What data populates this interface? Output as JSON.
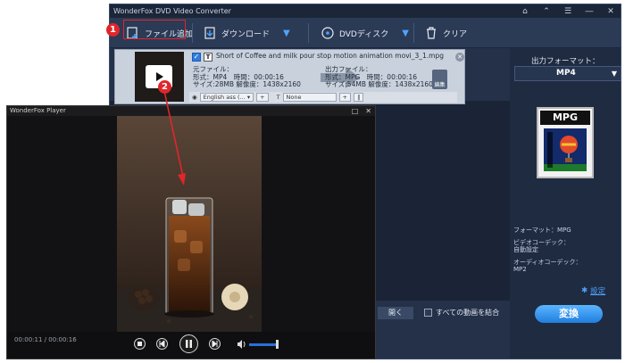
{
  "converter": {
    "title": "WonderFox DVD Video Converter",
    "window_controls": [
      "⌂",
      "⌃",
      "☰",
      "―",
      "✕"
    ],
    "toolbar": {
      "add_files_label": "ファイル追加",
      "download_label": "ダウンロード",
      "dvd_label": "DVDディスク",
      "clear_label": "クリア"
    },
    "file": {
      "name": "Short of Coffee and milk pour stop motion animation movi_3_1.mpg",
      "source_heading": "元ファイル：",
      "source_format": "形式：MP4　時間：00:00:16",
      "source_size": "サイズ:28MB 解像度：1438x2160",
      "output_heading": "出力ファイル：",
      "output_format": "形式：MPG　時間：00:00:16",
      "output_size": "サイズ:54MB 解像度：1438x2160",
      "edit_label": "編集",
      "subtitle_select": "English ass (... ▾",
      "audio_select": "None"
    },
    "right_panel": {
      "output_format_label": "出力フォーマット：",
      "selected_format": "MP4",
      "format_icon_text": "MPG",
      "format_line": "フォーマット：MPG",
      "video_codec_label": "ビデオコーデック：",
      "video_codec_value": "自動設定",
      "audio_codec_label": "オーディオコーデック：",
      "audio_codec_value": "MP2",
      "settings_label": "設定"
    },
    "bottom": {
      "open_label": "開く",
      "merge_label": "すべての動画を結合",
      "convert_label": "変換"
    }
  },
  "player": {
    "title": "WonderFox Player",
    "time_text": "00:00:11 / 00:00:16",
    "volume_level": 0.85
  },
  "annotations": {
    "step1": "1",
    "step2": "2"
  },
  "colors": {
    "accent": "#4ea3ff",
    "annotation_red": "#e0262b",
    "convert_button": "#1f7fe0"
  }
}
